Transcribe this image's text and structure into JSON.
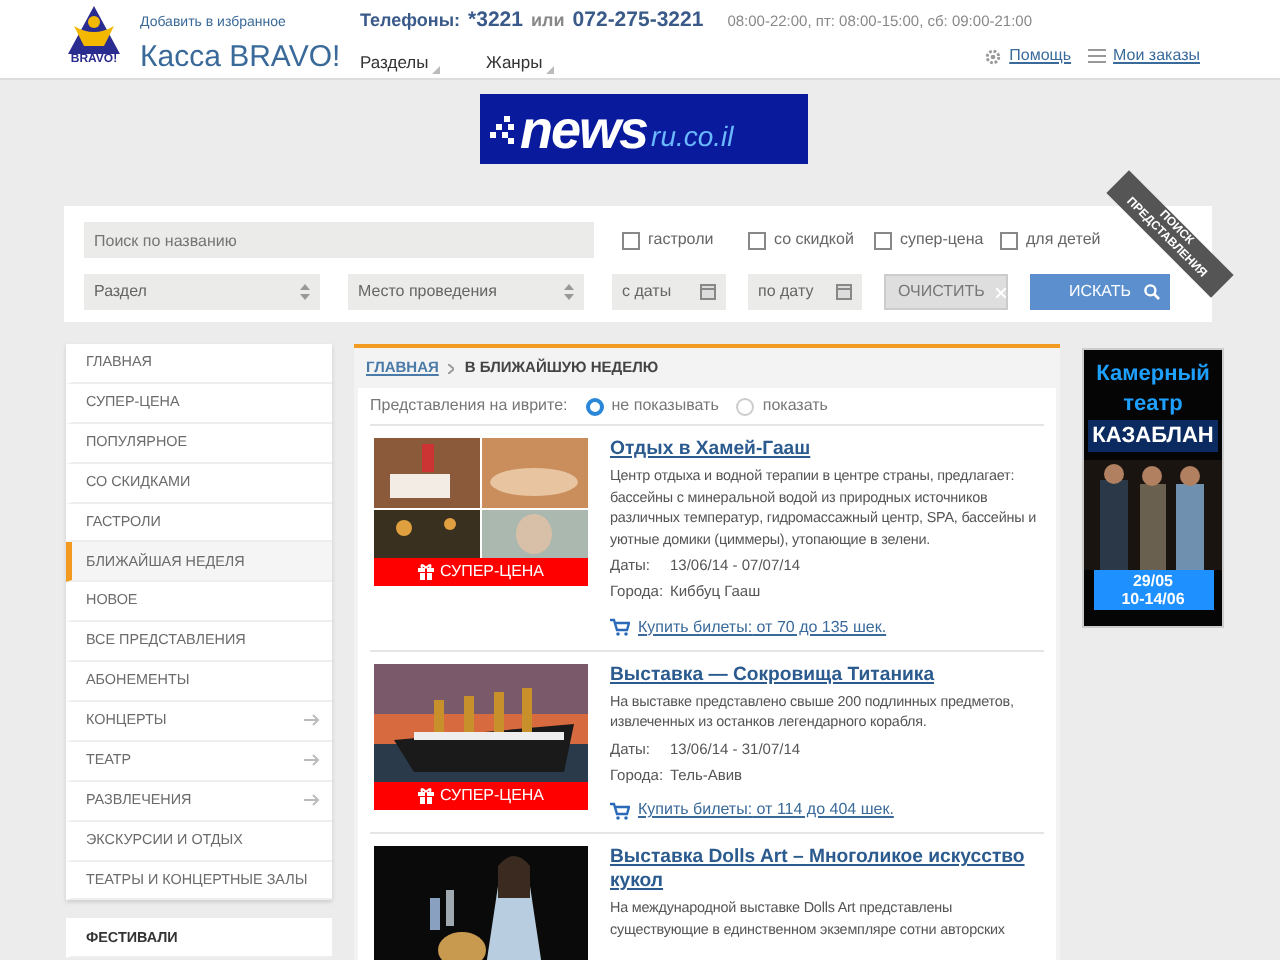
{
  "header": {
    "logo_text": "BRAVO!",
    "favorites_link": "Добавить в избранное",
    "site_title": "Касса BRAVO!",
    "phones_label": "Телефоны:",
    "phone_short": "*3221",
    "phones_or": "или",
    "phone_long": "072-275-3221",
    "hours": "08:00-22:00, пт: 08:00-15:00, сб: 09:00-21:00",
    "menus": [
      {
        "label": "Разделы"
      },
      {
        "label": "Жанры"
      }
    ],
    "links": [
      {
        "kind": "help",
        "label": "Помощь"
      },
      {
        "kind": "orders",
        "label": "Мои заказы"
      }
    ]
  },
  "banner": {
    "logo_main": "news",
    "logo_domain": "ru.co.il"
  },
  "search": {
    "placeholder": "Поиск по названию",
    "filters": [
      {
        "label": "гастроли",
        "checked": false
      },
      {
        "label": "со скидкой",
        "checked": false
      },
      {
        "label": "супер-цена",
        "checked": false
      },
      {
        "label": "для детей",
        "checked": false
      }
    ],
    "selects": [
      {
        "placeholder": "Раздел"
      },
      {
        "placeholder": "Место проведения"
      }
    ],
    "dates": [
      {
        "placeholder": "с даты"
      },
      {
        "placeholder": "по дату"
      }
    ],
    "clear_button": "ОЧИСТИТЬ",
    "search_button": "ИСКАТЬ",
    "ribbon": "ПОИСК ПРЕДСТАВЛЕНИЯ"
  },
  "sidebar": {
    "items": [
      {
        "label": "ГЛАВНАЯ",
        "selected": false,
        "submenu": false
      },
      {
        "label": "СУПЕР-ЦЕНА",
        "selected": false,
        "submenu": false
      },
      {
        "label": "ПОПУЛЯРНОЕ",
        "selected": false,
        "submenu": false
      },
      {
        "label": "СО СКИДКАМИ",
        "selected": false,
        "submenu": false
      },
      {
        "label": "ГАСТРОЛИ",
        "selected": false,
        "submenu": false
      },
      {
        "label": "БЛИЖАЙШАЯ НЕДЕЛЯ",
        "selected": true,
        "submenu": false
      },
      {
        "label": "НОВОЕ",
        "selected": false,
        "submenu": false
      },
      {
        "label": "ВСЕ ПРЕДСТАВЛЕНИЯ",
        "selected": false,
        "submenu": false
      },
      {
        "label": "АБОНЕМЕНТЫ",
        "selected": false,
        "submenu": false
      },
      {
        "label": "КОНЦЕРТЫ",
        "selected": false,
        "submenu": true
      },
      {
        "label": "ТЕАТР",
        "selected": false,
        "submenu": true
      },
      {
        "label": "РАЗВЛЕЧЕНИЯ",
        "selected": false,
        "submenu": true
      },
      {
        "label": "ЭКСКУРСИИ И ОТДЫХ",
        "selected": false,
        "submenu": false
      },
      {
        "label": "ТЕАТРЫ И КОНЦЕРТНЫЕ ЗАЛЫ",
        "selected": false,
        "submenu": false
      }
    ],
    "section": "ФЕСТИВАЛИ"
  },
  "breadcrumb": [
    {
      "label": "ГЛАВНАЯ",
      "kind": "link"
    },
    {
      "label": "В БЛИЖАЙШУЮ НЕДЕЛЮ",
      "kind": "current"
    }
  ],
  "hebrew_filter": {
    "label": "Представления на иврите:",
    "options": [
      {
        "label": "не показывать",
        "selected": true
      },
      {
        "label": "показать",
        "selected": false
      }
    ]
  },
  "events": [
    {
      "title": "Отдых в Хамей-Гааш",
      "description": "Центр отдыха и водной терапии в центре страны, предлагает: бассейны с минеральной водой из природных источников различных температур, гидромассажный центр, SPA, бассейны и уютные домики (циммеры), утопающие в зелени.",
      "dates_label": "Даты:",
      "dates": "13/06/14 - 07/07/14",
      "city_label": "Города:",
      "city": "Киббуц Гааш",
      "buy_link": "Купить билеты:",
      "price": "от 70 до 135 шек.",
      "badge": "СУПЕР-ЦЕНА"
    },
    {
      "title": "Выставка — Сокровища Титаника",
      "description": "На выставке представлено свыше 200 подлинных предметов, извлеченных из останков легендарного корабля.",
      "dates_label": "Даты:",
      "dates": "13/06/14 - 31/07/14",
      "city_label": "Города:",
      "city": "Тель-Авив",
      "buy_link": "Купить билеты:",
      "price": "от 114 до 404 шек.",
      "badge": "СУПЕР-ЦЕНА"
    },
    {
      "title": "Выставка Dolls Art – Многоликое искусство кукол",
      "description": "На международной выставке Dolls Art представлены существующие в единственном экземпляре сотни авторских"
    }
  ],
  "side_ad": {
    "line_1": "Камерный",
    "line_2": "театр",
    "name": "КАЗАБЛАН",
    "date_1": "29/05",
    "date_2": "10-14/06"
  }
}
